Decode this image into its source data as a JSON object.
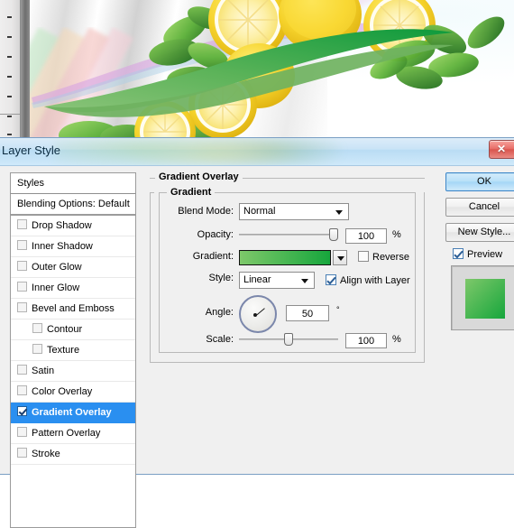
{
  "app": {
    "dialog_title": "Layer Style",
    "close_icon": "close-icon",
    "close_glyph": "✕"
  },
  "styles_panel": {
    "header": "Styles",
    "items": [
      {
        "label": "Blending Options: Default",
        "checkbox": false,
        "has_checkbox": false,
        "indent": false,
        "selected": false
      },
      {
        "label": "Drop Shadow",
        "checkbox": false,
        "has_checkbox": true,
        "indent": false,
        "selected": false
      },
      {
        "label": "Inner Shadow",
        "checkbox": false,
        "has_checkbox": true,
        "indent": false,
        "selected": false
      },
      {
        "label": "Outer Glow",
        "checkbox": false,
        "has_checkbox": true,
        "indent": false,
        "selected": false
      },
      {
        "label": "Inner Glow",
        "checkbox": false,
        "has_checkbox": true,
        "indent": false,
        "selected": false
      },
      {
        "label": "Bevel and Emboss",
        "checkbox": false,
        "has_checkbox": true,
        "indent": false,
        "selected": false
      },
      {
        "label": "Contour",
        "checkbox": false,
        "has_checkbox": true,
        "indent": true,
        "selected": false
      },
      {
        "label": "Texture",
        "checkbox": false,
        "has_checkbox": true,
        "indent": true,
        "selected": false
      },
      {
        "label": "Satin",
        "checkbox": false,
        "has_checkbox": true,
        "indent": false,
        "selected": false
      },
      {
        "label": "Color Overlay",
        "checkbox": false,
        "has_checkbox": true,
        "indent": false,
        "selected": false
      },
      {
        "label": "Gradient Overlay",
        "checkbox": true,
        "has_checkbox": true,
        "indent": false,
        "selected": true
      },
      {
        "label": "Pattern Overlay",
        "checkbox": false,
        "has_checkbox": true,
        "indent": false,
        "selected": false
      },
      {
        "label": "Stroke",
        "checkbox": false,
        "has_checkbox": true,
        "indent": false,
        "selected": false
      }
    ]
  },
  "main": {
    "section_title": "Gradient Overlay",
    "group_title": "Gradient",
    "blend_mode": {
      "label": "Blend Mode:",
      "value": "Normal"
    },
    "opacity": {
      "label": "Opacity:",
      "value": "100",
      "unit": "%",
      "percent": 100
    },
    "gradient": {
      "label": "Gradient:",
      "reverse_label": "Reverse",
      "reverse_checked": false,
      "color_start": "#7ec86a",
      "color_end": "#16a63c"
    },
    "style": {
      "label": "Style:",
      "value": "Linear",
      "align_label": "Align with Layer",
      "align_checked": true
    },
    "angle": {
      "label": "Angle:",
      "value": "50",
      "unit": "°",
      "degrees": 50
    },
    "scale": {
      "label": "Scale:",
      "value": "100",
      "unit": "%",
      "percent": 50
    }
  },
  "actions": {
    "ok": "OK",
    "cancel": "Cancel",
    "new_style": "New Style...",
    "preview_label": "Preview",
    "preview_checked": true
  },
  "colors": {
    "selection_blue": "#2a8ff0",
    "titlebar_blue": "#b9dcf4",
    "gradient_start": "#7ec86a",
    "gradient_end": "#16a63c",
    "swoosh_dark": "#1e9e43",
    "swoosh_light": "#7cbd6c"
  }
}
